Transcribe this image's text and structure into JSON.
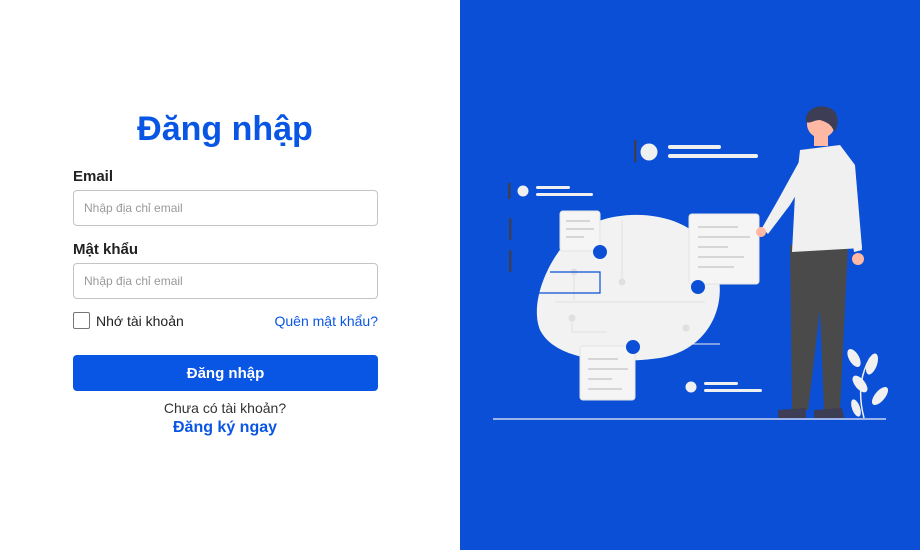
{
  "login": {
    "title": "Đăng nhập",
    "email_label": "Email",
    "email_placeholder": "Nhập địa chỉ email",
    "password_label": "Mật khẩu",
    "password_placeholder": "Nhập địa chỉ email",
    "remember_label": "Nhớ tài khoản",
    "forgot_link": "Quên mật khẩu?",
    "submit_label": "Đăng nhập",
    "no_account_text": "Chưa có tài khoản?",
    "signup_link": "Đăng ký ngay"
  },
  "theme": {
    "accent": "#0a56e4",
    "panel_background": "#0a4fd5"
  },
  "illustration": {
    "icon": "person-with-documents-illustration"
  }
}
